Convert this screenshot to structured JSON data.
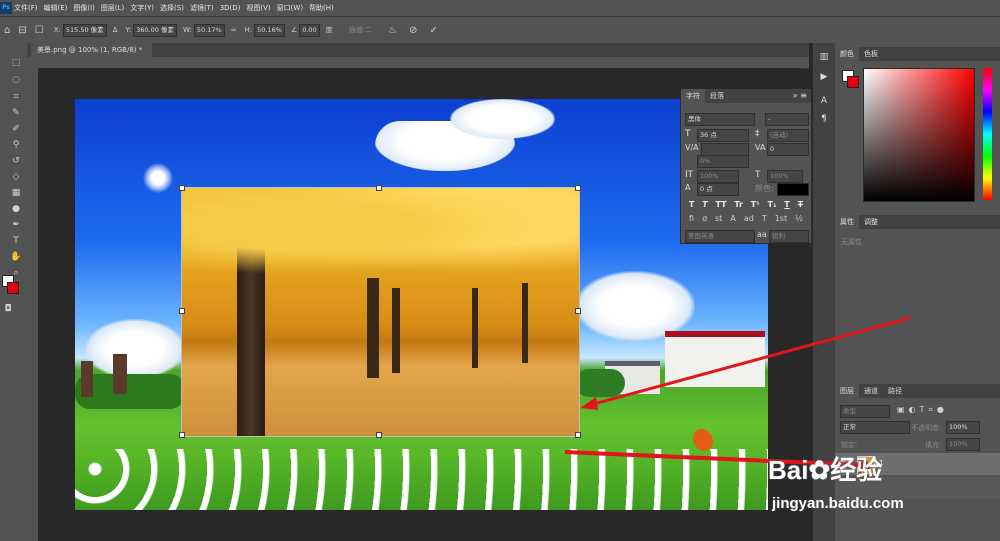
{
  "menu": [
    "文件(F)",
    "编辑(E)",
    "图像(I)",
    "图层(L)",
    "文字(Y)",
    "选择(S)",
    "滤镜(T)",
    "3D(D)",
    "视图(V)",
    "窗口(W)",
    "帮助(H)"
  ],
  "app_logo": "Ps",
  "options": {
    "x_label": "X:",
    "x_value": "515.50 像素",
    "y_label": "Y:",
    "y_value": "360.00 像素",
    "w_label": "W:",
    "w_value": "50.17%",
    "h_label": "H:",
    "h_value": "50.16%",
    "angle_value": "0.00",
    "degree": "度",
    "interp_label": "插值:二",
    "cancel_icon": "cancel-icon",
    "commit_icon": "check-icon"
  },
  "document": {
    "tab_title": "美景.png @ 100% (1, RGB/8) *",
    "close": "×"
  },
  "character_panel": {
    "tabs": [
      "字符",
      "段落"
    ],
    "font_family": "黑体",
    "font_style": "-",
    "font_size": "36 点",
    "leading": "(自动)",
    "tracking": "0",
    "scale_v": "100%",
    "scale_h": "100%",
    "baseline": "0 点",
    "color_label": "颜色:",
    "styles": [
      "T",
      "T",
      "TT",
      "Tr",
      "T¹",
      "T₁",
      "T",
      "T"
    ],
    "language": "美国英语",
    "aa_label": "aa",
    "aa_value": "锐利"
  },
  "color_panel": {
    "tabs": [
      "颜色",
      "色板"
    ],
    "fg_color": "#ffffff",
    "bg_color": "#e60012"
  },
  "properties_panel": {
    "tabs": [
      "属性",
      "调整"
    ],
    "empty_text": "无属性"
  },
  "layers_panel": {
    "tabs": [
      "图层",
      "通道",
      "路径"
    ],
    "filter_label": "类型",
    "blend_mode": "正常",
    "opacity_label": "不透明度:",
    "opacity_value": "100%",
    "lock_label": "锁定:",
    "fill_label": "填充:",
    "fill_value": "100%",
    "layer_name": "1"
  },
  "watermark": {
    "brand_left": "Bai",
    "brand_right": "经验",
    "url": "jingyan.baidu.com"
  }
}
